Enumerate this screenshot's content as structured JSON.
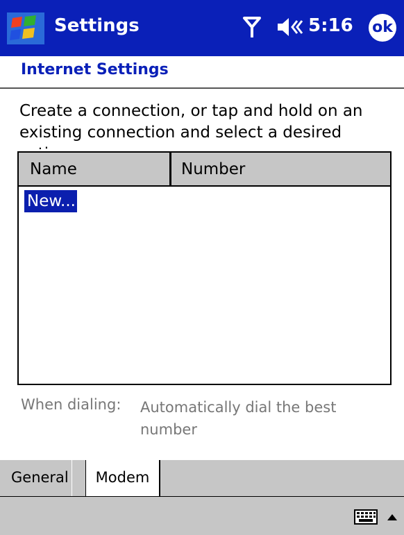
{
  "titlebar": {
    "title": "Settings",
    "clock": "5:16",
    "ok_label": "ok"
  },
  "page": {
    "title": "Internet Settings",
    "instruction": "Create a connection, or tap and hold on an existing connection and select a desired action."
  },
  "connections_list": {
    "columns": [
      "Name",
      "Number"
    ],
    "rows": [
      {
        "name": "New...",
        "number": "",
        "selected": true
      }
    ]
  },
  "dialing": {
    "label": "When dialing:",
    "value": "Automatically dial the best number"
  },
  "tabs": [
    {
      "label": "General",
      "active": false
    },
    {
      "label": "Modem",
      "active": true
    }
  ],
  "colors": {
    "titlebar_bg": "#0a20b8",
    "accent": "#0a20b8",
    "selection_bg": "#0b1fae",
    "bar_gray": "#c6c6c6",
    "muted_text": "#777777"
  },
  "icons": [
    "windows-start-icon",
    "antenna-icon",
    "speaker-icon",
    "ok-icon",
    "keyboard-icon",
    "up-arrow-icon"
  ]
}
